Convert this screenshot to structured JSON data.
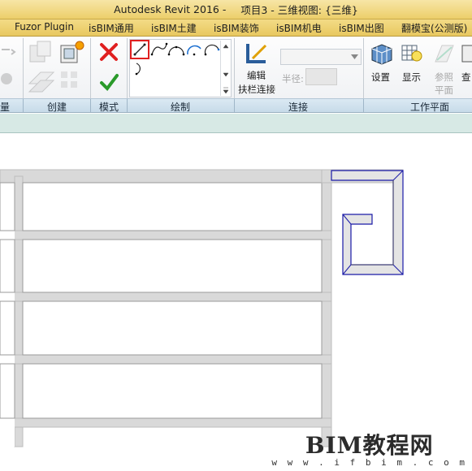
{
  "window": {
    "app_title": "Autodesk Revit 2016 -",
    "doc_title": "项目3 - 三维视图: {三维}"
  },
  "tabs": [
    "Fuzor Plugin",
    "isBIM通用",
    "isBIM土建",
    "isBIM装饰",
    "isBIM机电",
    "isBIM出图",
    "翻模宝(公测版)"
  ],
  "panels": {
    "measure": "量",
    "create": "创建",
    "mode": "模式",
    "draw": "绘制",
    "connect": "连接",
    "workplane": "工作平面"
  },
  "connect": {
    "edit_line1": "编辑",
    "edit_line2": "扶栏连接",
    "radius_label": "半径:",
    "dropdown_value": "",
    "radius_value": ""
  },
  "workplane": {
    "set_label": "设置",
    "show_label": "显示",
    "ref_line1": "参照",
    "ref_line2": "平面",
    "viewer_label": "查"
  },
  "watermark": {
    "title": "BIM教程网",
    "url": "w w w . i f b i m . c o m"
  },
  "colors": {
    "accent_red": "#e02020",
    "selection_blue": "#1a1aa8",
    "rail_gray": "#d4d4d4"
  }
}
